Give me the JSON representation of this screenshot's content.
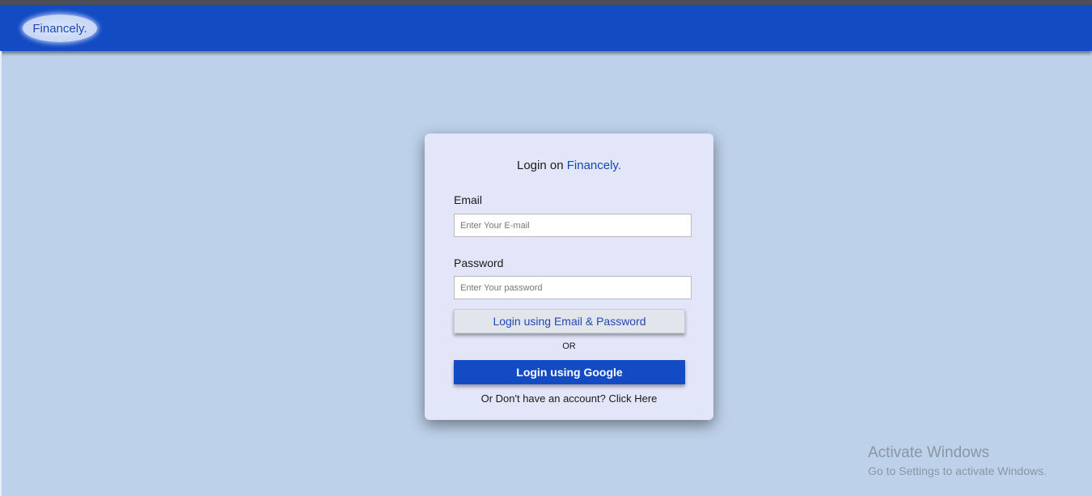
{
  "header": {
    "logo_text": "Financely."
  },
  "login_card": {
    "title_prefix": "Login on ",
    "title_brand": "Financely.",
    "email_label": "Email",
    "email_placeholder": "Enter Your E-mail",
    "email_value": "",
    "password_label": "Password",
    "password_placeholder": "Enter Your password",
    "password_value": "",
    "email_login_button": "Login using Email & Password",
    "or_text": "OR",
    "google_login_button": "Login using Google",
    "signup_link": "Or Don't have an account? Click Here"
  },
  "watermark": {
    "title": "Activate Windows",
    "subtitle": "Go to Settings to activate Windows."
  },
  "colors": {
    "navbar": "#124bc2",
    "page_background": "#bdd1ea",
    "card_background": "#e2e6f8",
    "brand_text": "#1648b8"
  }
}
